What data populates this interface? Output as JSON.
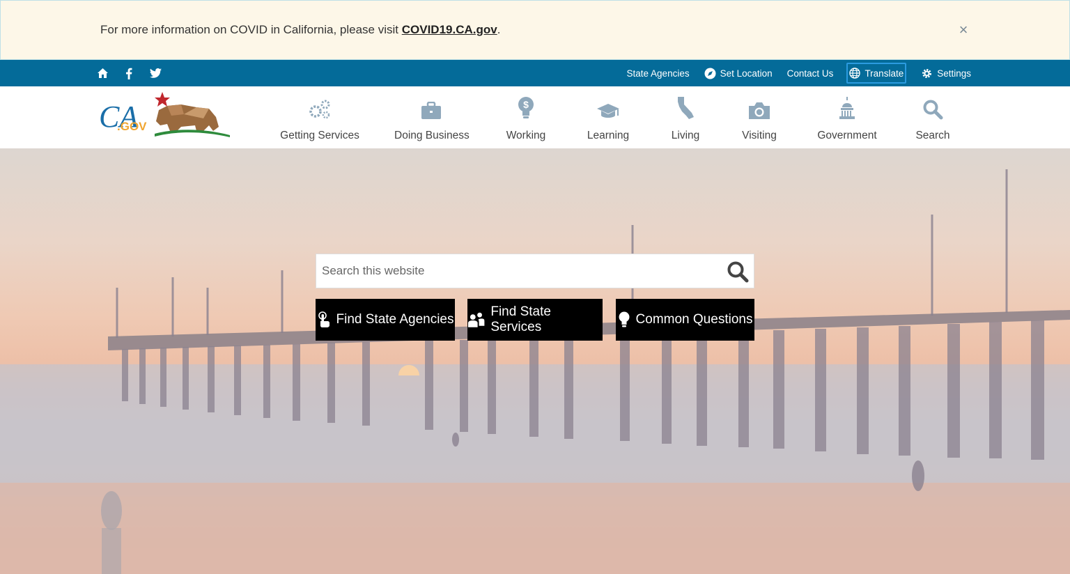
{
  "alert": {
    "text_before": "For more information on COVID in California, please visit ",
    "link_text": "COVID19.CA.gov",
    "text_after": ".",
    "close": "×"
  },
  "utility": {
    "left_icons": [
      "home-icon",
      "facebook-icon",
      "twitter-icon"
    ],
    "links": {
      "state_agencies": "State Agencies",
      "set_location": "Set Location",
      "contact_us": "Contact Us",
      "translate": "Translate",
      "settings": "Settings"
    }
  },
  "logo": {
    "ca": "CA",
    "gov": ".GOV"
  },
  "nav": {
    "getting_services": "Getting Services",
    "doing_business": "Doing Business",
    "working": "Working",
    "learning": "Learning",
    "living": "Living",
    "visiting": "Visiting",
    "government": "Government",
    "search": "Search"
  },
  "hero": {
    "search_placeholder": "Search this website",
    "buttons": {
      "agencies": "Find State Agencies",
      "services": "Find State Services",
      "questions": "Common Questions"
    }
  },
  "colors": {
    "utility_bar": "#046b99",
    "alert_bg": "#fdf7e8",
    "nav_icon": "#8fa8bb",
    "button_bg": "#000000"
  }
}
